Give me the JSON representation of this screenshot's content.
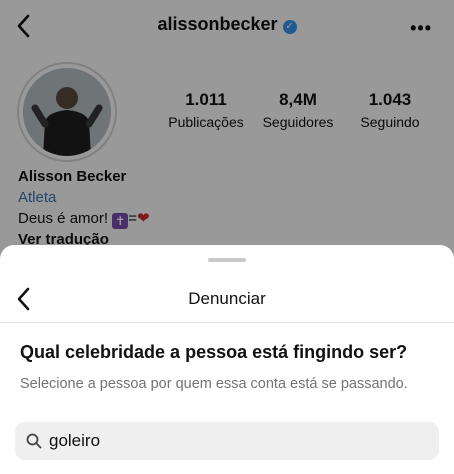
{
  "profile": {
    "username": "alissonbecker",
    "stats": [
      {
        "value": "1.011",
        "label": "Publicações"
      },
      {
        "value": "8,4M",
        "label": "Seguidores"
      },
      {
        "value": "1.043",
        "label": "Seguindo"
      }
    ],
    "bio": {
      "name": "Alisson Becker",
      "category": "Atleta",
      "text": "Deus é amor!",
      "equals": "=",
      "see_translation": "Ver tradução"
    }
  },
  "sheet": {
    "title": "Denunciar",
    "question": "Qual celebridade a pessoa está fingindo ser?",
    "hint": "Selecione a pessoa por quem essa conta está se passando.",
    "search_value": "goleiro"
  },
  "icons": {
    "back": "chevron-left-icon",
    "verified": "verified-badge-icon",
    "more": "more-horizontal-icon",
    "search": "search-icon",
    "cross": "latin-cross-emoji",
    "heart": "red-heart-emoji"
  },
  "colors": {
    "verified": "#3897f0",
    "category_link": "#3b74b6",
    "overlay": "rgba(0,0,0,0.40)",
    "search_bg": "#efefef"
  }
}
